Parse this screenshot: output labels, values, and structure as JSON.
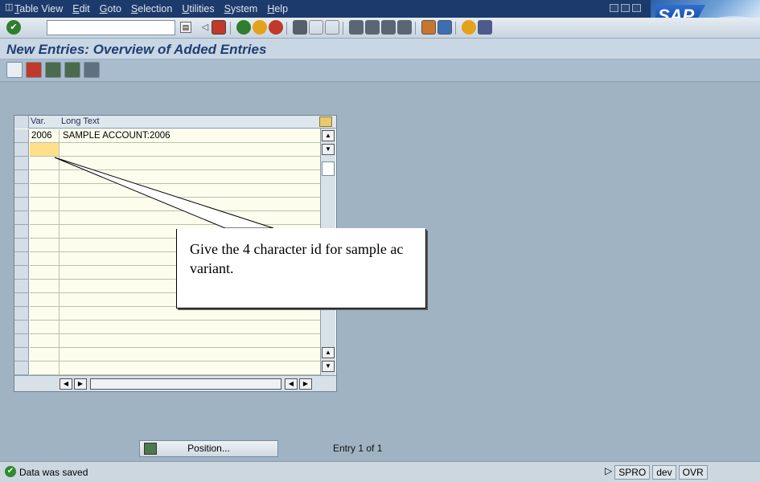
{
  "menubar": {
    "items": [
      "Table View",
      "Edit",
      "Goto",
      "Selection",
      "Utilities",
      "System",
      "Help"
    ],
    "logo_text": "SAP"
  },
  "toolbar": {
    "command_field": "",
    "icons": [
      "enter-icon",
      "save-icon",
      "back-icon",
      "exit-icon",
      "cancel-icon",
      "print-icon",
      "find-icon",
      "find-next-icon",
      "first-page-icon",
      "previous-page-icon",
      "next-page-icon",
      "last-page-icon",
      "create-session-icon",
      "shortcut-icon",
      "help-icon",
      "customize-layout-icon"
    ]
  },
  "title": "New Entries: Overview of Added Entries",
  "app_toolbar": {
    "icons": [
      "edit-icon",
      "save-entries-icon",
      "select-all-icon",
      "select-block-icon",
      "deselect-all-icon"
    ]
  },
  "table": {
    "columns": [
      "Var.",
      "Long Text"
    ],
    "rows": [
      {
        "var": "2006",
        "long_text": "SAMPLE ACCOUNT:2006"
      },
      {
        "var": "",
        "long_text": ""
      }
    ],
    "empty_row_count": 16
  },
  "callout": {
    "text": "Give the 4 character id for sample ac variant."
  },
  "position_button": "Position...",
  "entry_info": "Entry 1 of 1",
  "status": {
    "message": "Data was saved",
    "fields": [
      "SPRO",
      "dev",
      "OVR"
    ]
  },
  "colors": {
    "menubar_bg": "#1c3a6b",
    "background": "#9fb3c3",
    "title_text": "#203e72",
    "focus_cell": "#ffe08a"
  }
}
